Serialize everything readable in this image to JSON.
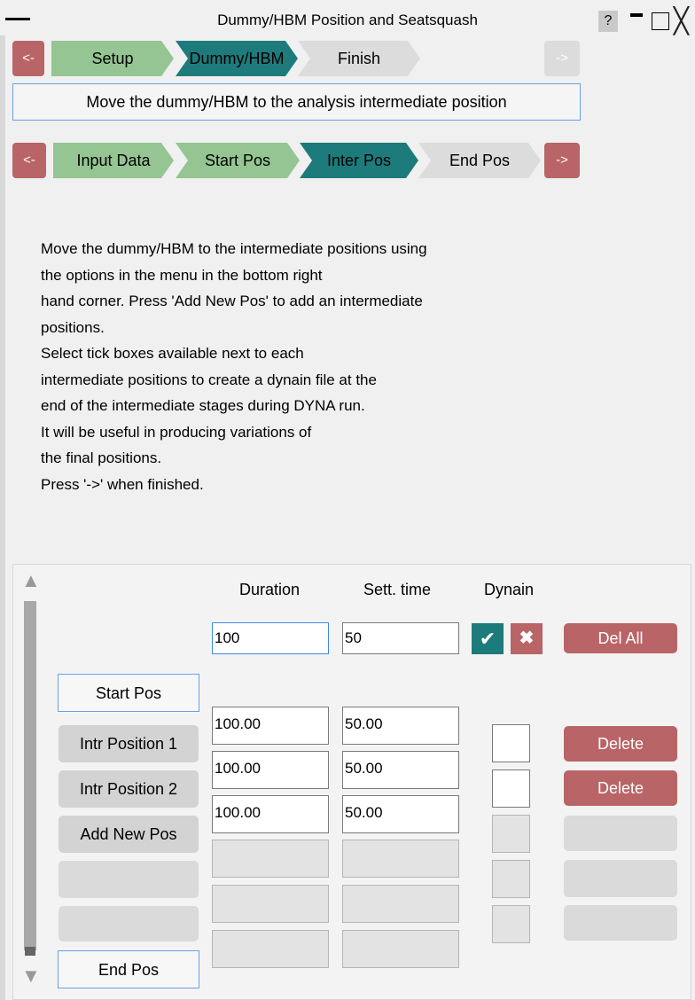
{
  "window": {
    "title": "Dummy/HBM Position and Seatsquash",
    "help_label": "?",
    "close_glyph": "╳"
  },
  "workflow": {
    "back_label": "<-",
    "next_label": "->",
    "steps": [
      "Setup",
      "Dummy/HBM",
      "Finish"
    ],
    "active_step": "Dummy/HBM"
  },
  "message": "Move the dummy/HBM to the analysis intermediate position",
  "substeps": {
    "back_label": "<-",
    "next_label": "->",
    "steps": [
      "Input Data",
      "Start Pos",
      "Inter Pos",
      "End Pos"
    ],
    "active_step": "Inter Pos"
  },
  "instructions": [
    "Move the dummy/HBM to the intermediate positions using",
    "the options in the menu in the bottom right",
    "hand corner. Press 'Add New Pos' to add an intermediate",
    "positions.",
    "Select tick boxes available next to each",
    "intermediate positions to create a dynain file at the",
    "end of the intermediate stages during DYNA run.",
    "It will be useful in producing variations of",
    "the final positions.",
    "Press '->' when finished."
  ],
  "table": {
    "headers": {
      "duration": "Duration",
      "sett_time": "Sett. time",
      "dynain": "Dynain"
    },
    "global_inputs": {
      "duration": "100",
      "sett_time": "50"
    },
    "tick_glyph": "✔",
    "cross_glyph": "✖",
    "del_all_label": "Del All",
    "start_pos_label": "Start Pos",
    "end_pos_label": "End Pos",
    "rows": [
      {
        "label": "Intr Position 1",
        "duration": "100.00",
        "sett_time": "50.00",
        "delete_label": "Delete"
      },
      {
        "label": "Intr Position 2",
        "duration": "100.00",
        "sett_time": "50.00",
        "delete_label": "Delete"
      },
      {
        "label": "Add New Pos",
        "duration": "100.00",
        "sett_time": "50.00",
        "delete_label": ""
      }
    ]
  },
  "colors": {
    "done_step": "#94c592",
    "active_step": "#1e7b7b",
    "pending_step": "#dcdcdc",
    "red_button": "#b96466",
    "focus_border": "#6aa0e8"
  }
}
